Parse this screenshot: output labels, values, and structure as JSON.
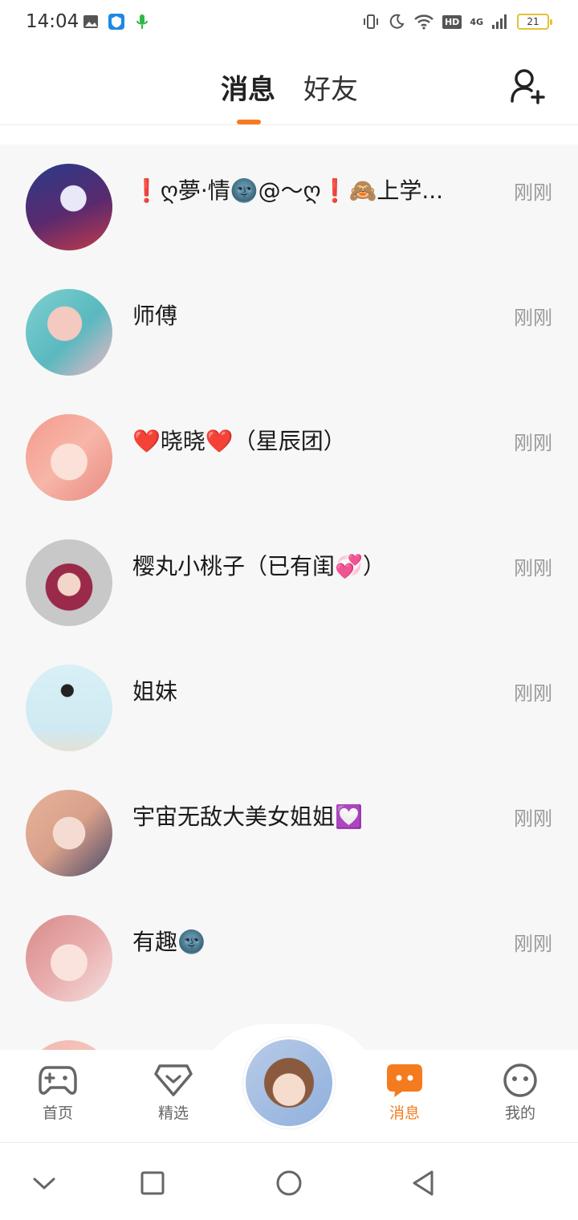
{
  "status_bar": {
    "time": "14:04",
    "hd": "HD",
    "network": "4G",
    "battery": "21",
    "battery_color": "#e2c23a"
  },
  "header": {
    "tabs": [
      {
        "label": "消息",
        "active": true
      },
      {
        "label": "好友",
        "active": false
      }
    ],
    "accent_color": "#f57b1f"
  },
  "conversations": [
    {
      "name": "❗️ღ夢·情🌚@～ღ❗️🙈上学...",
      "time": "刚刚"
    },
    {
      "name": "师傅",
      "time": "刚刚"
    },
    {
      "name": "❤️晓晓❤️（星辰团）",
      "time": "刚刚"
    },
    {
      "name": "樱丸小桃子（已有闺💞）",
      "time": "刚刚"
    },
    {
      "name": "姐妹",
      "time": "刚刚"
    },
    {
      "name": "宇宙无敌大美女姐姐💟",
      "time": "刚刚"
    },
    {
      "name": "有趣🌚",
      "time": "刚刚"
    }
  ],
  "bottom_nav": {
    "items": [
      {
        "label": "首页",
        "icon": "gamepad-icon"
      },
      {
        "label": "精选",
        "icon": "heart-chat-icon"
      },
      {
        "label": "消息",
        "icon": "message-bubble-icon",
        "active": true
      },
      {
        "label": "我的",
        "icon": "face-icon"
      }
    ]
  }
}
